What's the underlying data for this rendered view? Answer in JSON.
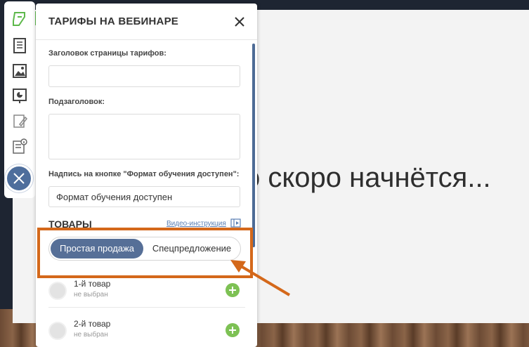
{
  "stage": {
    "headline": "о скоро начнётся..."
  },
  "rail": {
    "items": [
      {
        "icon": "tariff-icon",
        "active": true
      },
      {
        "icon": "notebook-icon",
        "active": false
      },
      {
        "icon": "image-icon",
        "active": false
      },
      {
        "icon": "presentation-icon",
        "active": false
      },
      {
        "icon": "edit-page-icon",
        "active": false
      },
      {
        "icon": "info-doc-icon",
        "active": false
      }
    ],
    "close_icon": "close-icon",
    "accent_color": "#5db84a"
  },
  "panel": {
    "title": "ТАРИФЫ НА ВЕБИНАРЕ",
    "fields": {
      "page_title_label": "Заголовок страницы тарифов:",
      "page_title_value": "",
      "subtitle_label": "Подзаголовок:",
      "subtitle_value": "",
      "button_label": "Надпись на кнопке \"Формат обучения доступен\":",
      "button_value": "Формат обучения доступен"
    },
    "products": {
      "section_title": "ТОВАРЫ",
      "video_link": "Видео-инструкция",
      "toggle": {
        "active": "Простая продажа",
        "inactive": "Спецпредложение"
      },
      "items": [
        {
          "name": "1-й товар",
          "status": "не выбран"
        },
        {
          "name": "2-й товар",
          "status": "не выбран"
        }
      ]
    },
    "colors": {
      "toggle_active": "#566f97",
      "add_button": "#7dc154",
      "link": "#5b7fb3"
    }
  },
  "annotation": {
    "color": "#d4681a"
  }
}
